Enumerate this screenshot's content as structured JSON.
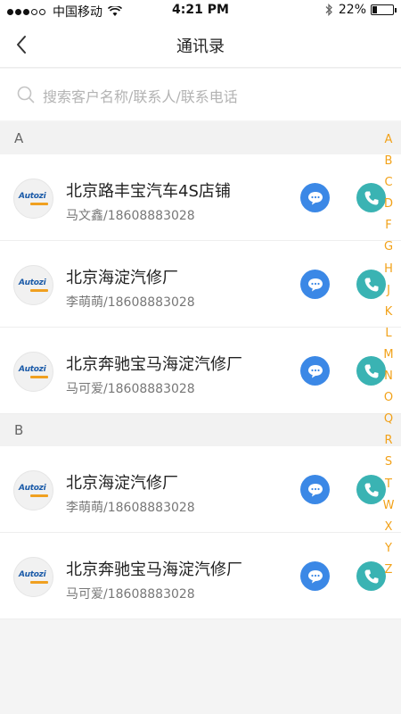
{
  "status_bar": {
    "carrier": "中国移动",
    "time": "4:21 PM",
    "battery": "22%",
    "battery_level": 0.22,
    "icons": [
      "signal-dots-icon",
      "wifi-icon",
      "bluetooth-icon",
      "battery-icon"
    ]
  },
  "nav": {
    "title": "通讯录",
    "back_icon": "chevron-left-icon"
  },
  "search": {
    "placeholder": "搜索客户名称/联系人/联系电话",
    "icon": "search-icon"
  },
  "sections": [
    {
      "letter": "A",
      "contacts": [
        {
          "name": "北京路丰宝汽车4S店铺",
          "detail": "马文鑫/18608883028"
        },
        {
          "name": "北京海淀汽修厂",
          "detail": "李萌萌/18608883028"
        },
        {
          "name": "北京奔驰宝马海淀汽修厂",
          "detail": "马可爱/18608883028"
        }
      ]
    },
    {
      "letter": "B",
      "contacts": [
        {
          "name": "北京海淀汽修厂",
          "detail": "李萌萌/18608883028"
        },
        {
          "name": "北京奔驰宝马海淀汽修厂",
          "detail": "马可爱/18608883028"
        }
      ]
    }
  ],
  "avatar_logo_text": "Autozi",
  "index_letters": [
    "A",
    "B",
    "C",
    "D",
    "F",
    "G",
    "H",
    "J",
    "K",
    "L",
    "M",
    "N",
    "O",
    "Q",
    "R",
    "S",
    "T",
    "W",
    "X",
    "Y",
    "Z"
  ],
  "colors": {
    "chat_button": "#3b88e6",
    "phone_button": "#3ab3b3",
    "index_letter": "#f2a21a",
    "section_bg": "#f2f2f2"
  }
}
